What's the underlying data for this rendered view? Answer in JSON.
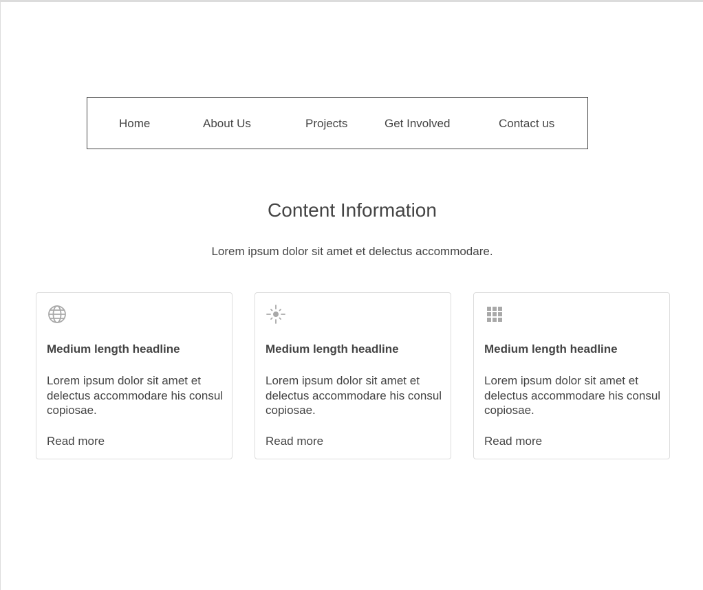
{
  "nav": {
    "items": [
      {
        "label": "Home"
      },
      {
        "label": "About Us"
      },
      {
        "label": "Projects"
      },
      {
        "label": "Get Involved"
      },
      {
        "label": "Contact us"
      }
    ]
  },
  "main": {
    "title": "Content Information",
    "subtitle": "Lorem ipsum dolor sit amet et delectus accommodare."
  },
  "cards": [
    {
      "icon": "globe-icon",
      "headline": "Medium length headline",
      "body": "Lorem ipsum dolor sit amet et delectus accommodare his consul copiosae.",
      "link": "Read more"
    },
    {
      "icon": "sun-icon",
      "headline": "Medium length headline",
      "body": "Lorem ipsum dolor sit amet et delectus accommodare his consul copiosae.",
      "link": "Read more"
    },
    {
      "icon": "grid-icon",
      "headline": "Medium length headline",
      "body": "Lorem ipsum dolor sit amet et delectus accommodare his consul copiosae.",
      "link": "Read more"
    }
  ],
  "colors": {
    "text": "#444444",
    "icon": "#a9a9a9",
    "border": "#dcdcdc",
    "nav_border": "#444444"
  }
}
